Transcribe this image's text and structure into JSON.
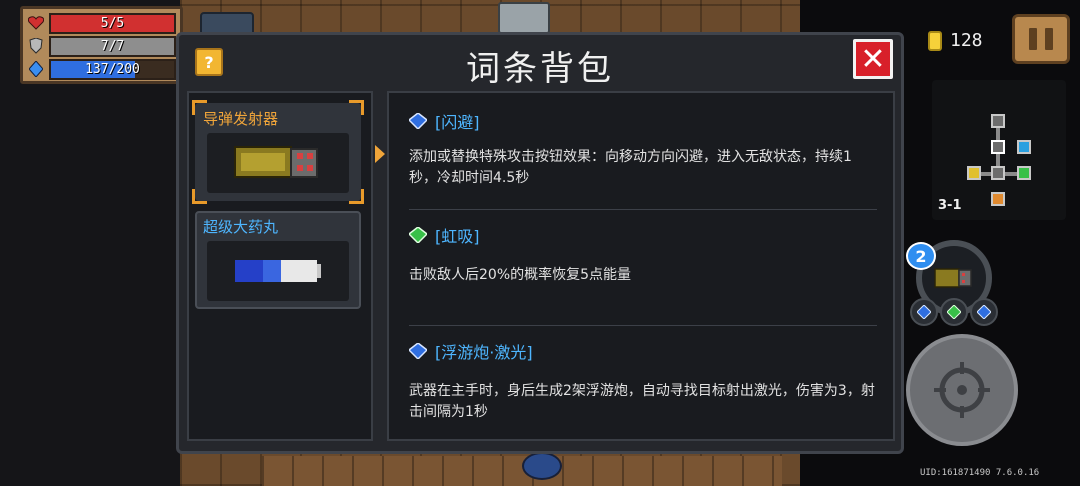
{
  "hud": {
    "hp": "5/5",
    "armor": "7/7",
    "energy": "137/200",
    "energy_fraction": 0.685
  },
  "modal": {
    "title": "词条背包",
    "help_label": "?",
    "close_icon": "close-icon"
  },
  "items": [
    {
      "name": "导弹发射器",
      "selected": true
    },
    {
      "name": "超级大药丸",
      "selected": false
    }
  ],
  "entries": [
    {
      "title": "[闪避]",
      "gem_color": "#2f6ee0",
      "desc": "添加或替换特殊攻击按钮效果：向移动方向闪避，进入无敌状态，持续1秒，冷却时间4.5秒"
    },
    {
      "title": "[虹吸]",
      "gem_color": "#38c048",
      "desc": "击败敌人后20%的概率恢复5点能量"
    },
    {
      "title": "[浮游炮·激光]",
      "gem_color": "#2f6ee0",
      "desc": "武器在主手时，身后生成2架浮游炮，自动寻找目标射出激光，伤害为3，射击间隔为1秒"
    }
  ],
  "coins": "128",
  "minimap": {
    "level_label": "3-1"
  },
  "weapon": {
    "ammo_badge": "2"
  },
  "footer": {
    "uid": "UID:161871490 7.6.0.16"
  },
  "colors": {
    "accent_orange": "#f0a53a",
    "entry_title_blue": "#4eb6ff",
    "close_red": "#d8202a"
  }
}
